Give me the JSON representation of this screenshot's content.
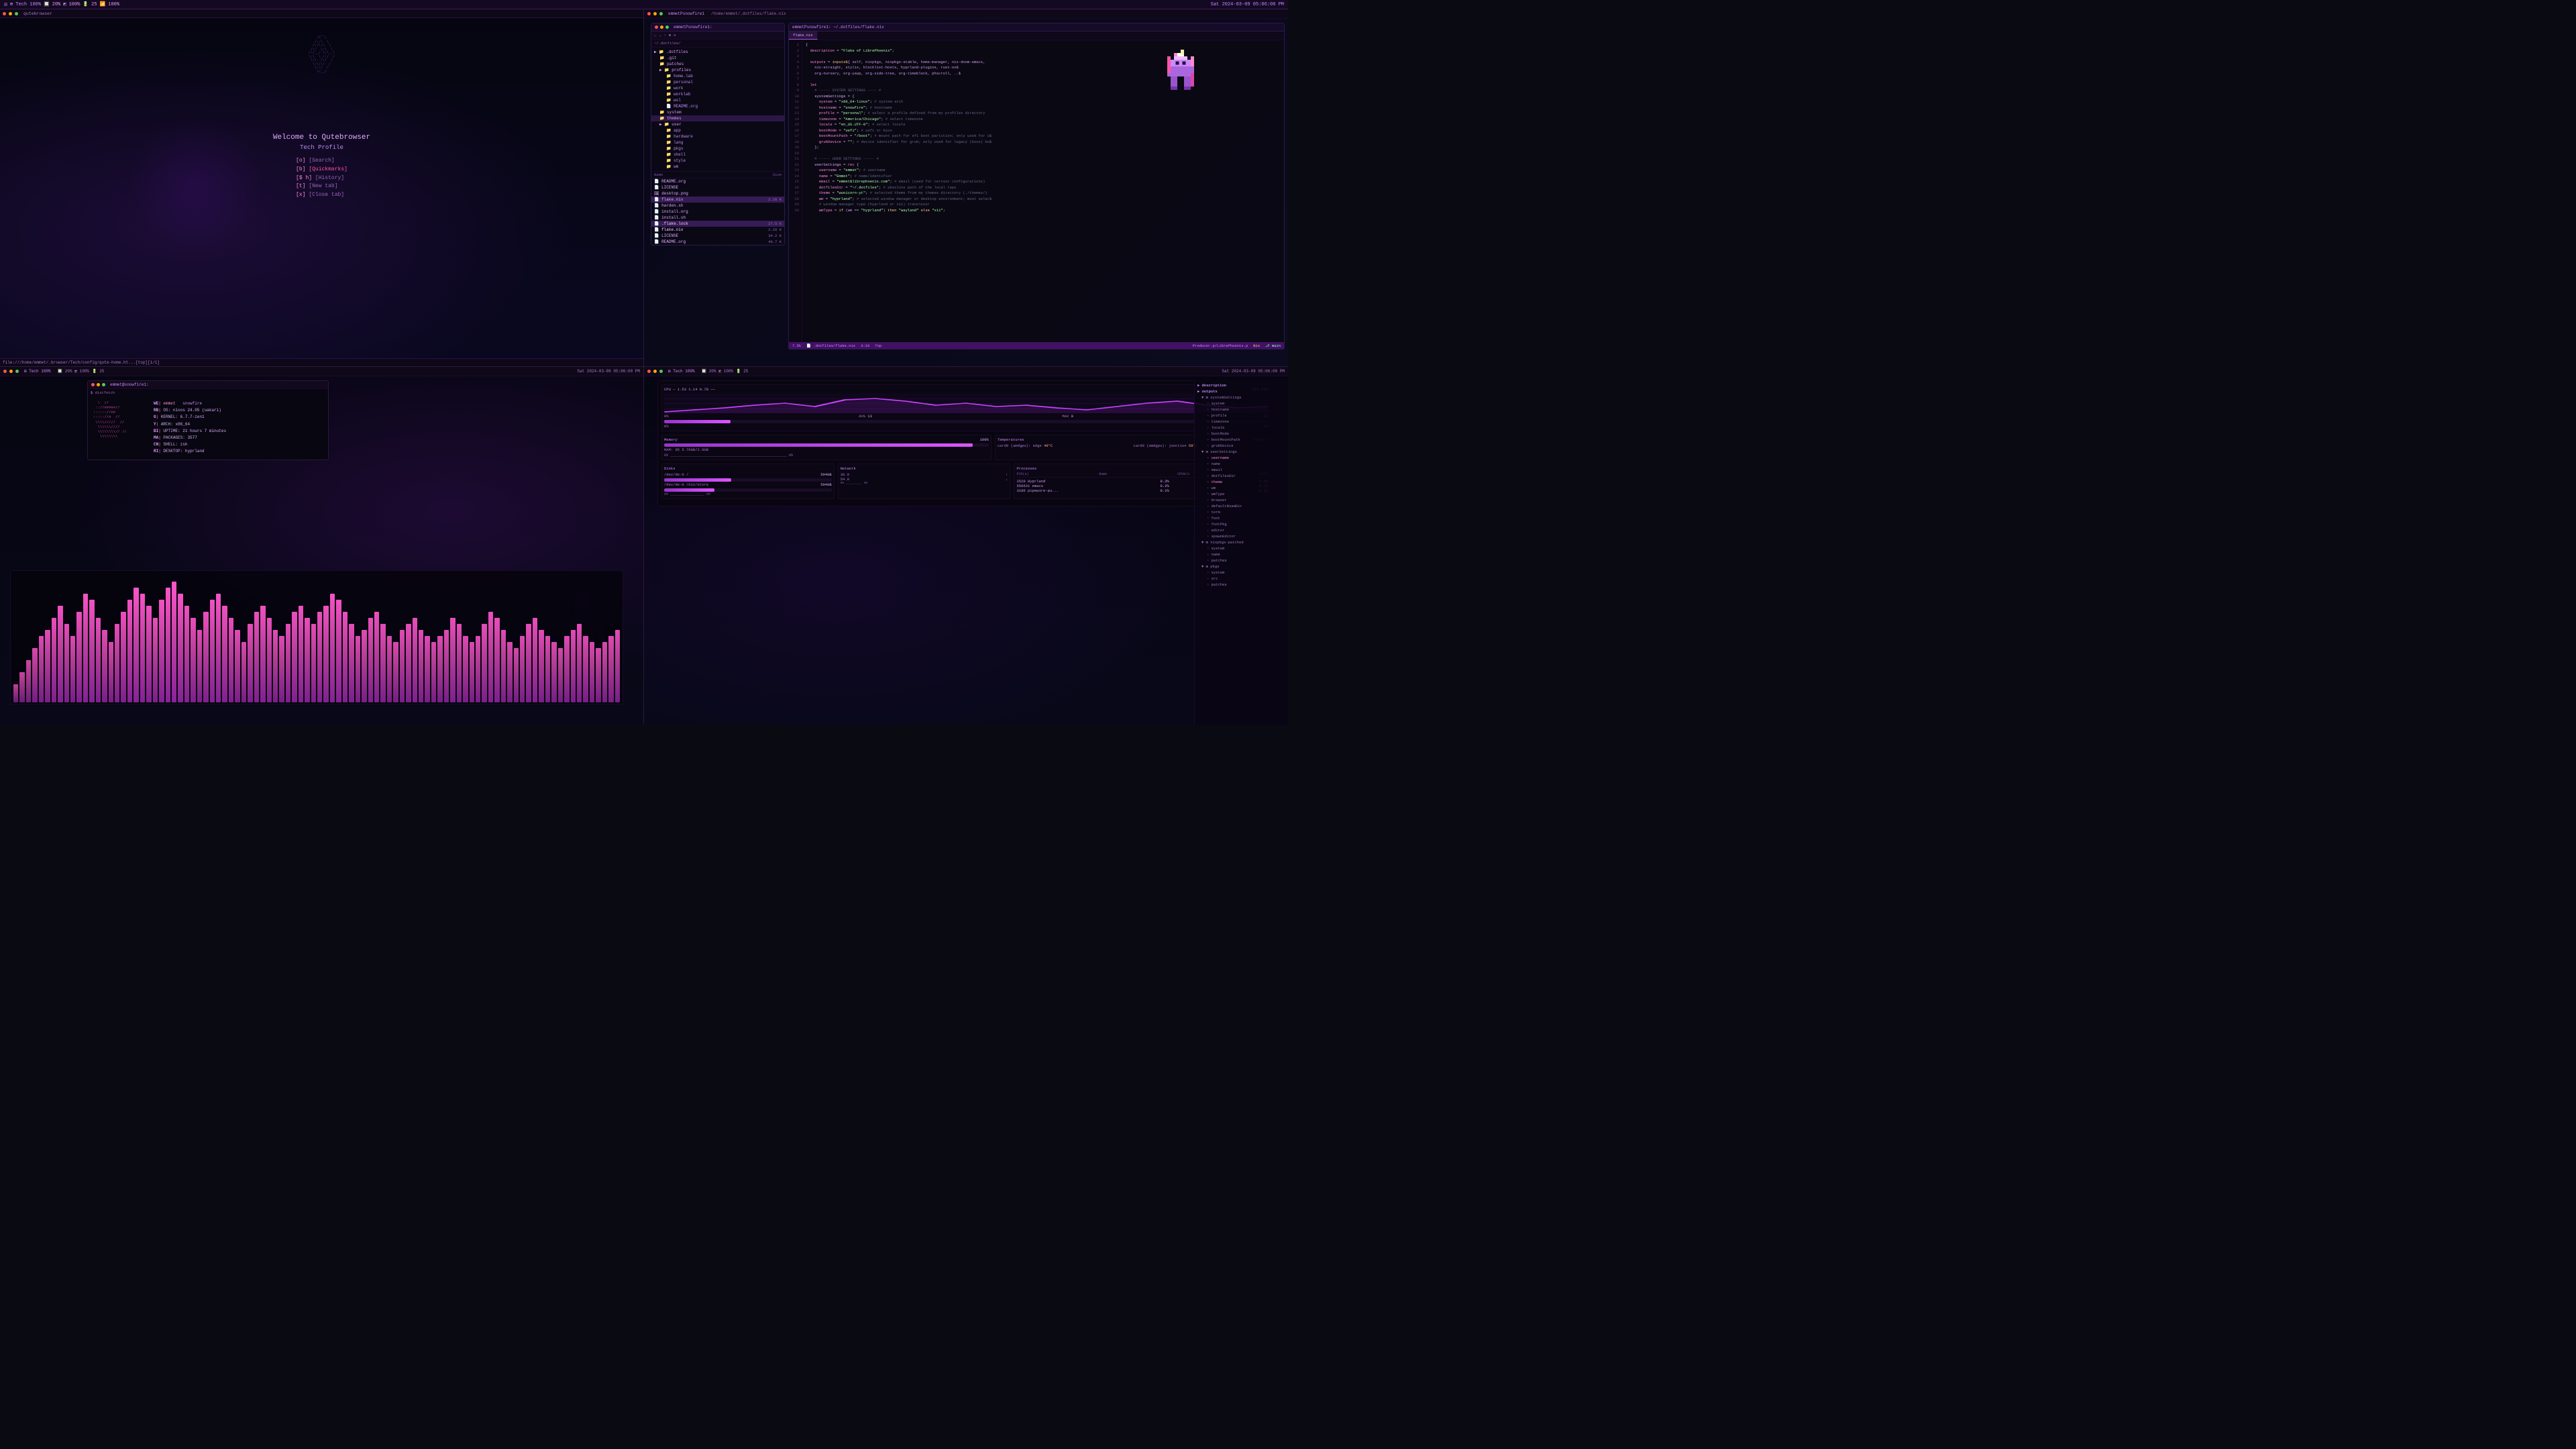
{
  "topbar": {
    "left": {
      "apps": "⊞ Tech 100%",
      "cpu": "20%",
      "mem_icon": "◩",
      "mem": "100%",
      "bat": "25",
      "bat_icon": "🔋",
      "wifi": "100%",
      "sep1": "|"
    },
    "right": {
      "datetime": "Sat 2024-03-09 05:06:00 PM",
      "wifi2": "100%"
    }
  },
  "q1": {
    "title": "qutebrowser",
    "ascii": "     ,----,\n  ,/   .`|  ___\n,`   .'  :,' ,'\n;    ;     ; |\n,'   |  .\\  \\ |\n|    |  | ; | |\n:    ' /  | ' |\n|    |/   ' ; |\n;    ;    / | |\n`----'   ;  | |\n        /   | |\n       /    | |\n      ;     | |\n      |     | |\n       \\    |\n        \\   |\n         \\  |\n          `--'",
    "welcome": "Welcome to Qutebrowser",
    "profile": "Tech Profile",
    "commands": [
      {
        "key": "[o]",
        "label": "[Search]"
      },
      {
        "key": "[b]",
        "label": "[Quickmarks]",
        "highlight": true
      },
      {
        "key": "[$ h]",
        "label": "[History]"
      },
      {
        "key": "[t]",
        "label": "[New tab]"
      },
      {
        "key": "[x]",
        "label": "[Close tab]"
      }
    ],
    "statusbar": "file:///home/emmet/.browser/Tech/config/qute-home.ht...[top][1/1]"
  },
  "q2": {
    "title": "emmetPsnowfire1",
    "path": "/home/emmet/.dotfiles/flake.nix",
    "file_manager": {
      "title": "emmetPsnowfire1:",
      "toolbar_items": [
        "←",
        "→",
        "↑",
        "⊞",
        "≡"
      ],
      "path": "~/.dotfiles/",
      "tree": [
        {
          "name": ".dotfiles",
          "type": "folder",
          "indent": 0,
          "open": true
        },
        {
          "name": ".git",
          "type": "folder",
          "indent": 1
        },
        {
          "name": "patches",
          "type": "folder",
          "indent": 1
        },
        {
          "name": "profiles",
          "type": "folder",
          "indent": 1,
          "open": true
        },
        {
          "name": "home.lab",
          "type": "folder",
          "indent": 2
        },
        {
          "name": "personal",
          "type": "folder",
          "indent": 2
        },
        {
          "name": "work",
          "type": "folder",
          "indent": 2
        },
        {
          "name": "worklab",
          "type": "folder",
          "indent": 2
        },
        {
          "name": "wsl",
          "type": "folder",
          "indent": 2
        },
        {
          "name": "README.org",
          "type": "file",
          "indent": 2
        },
        {
          "name": "system",
          "type": "folder",
          "indent": 1
        },
        {
          "name": "themes",
          "type": "folder",
          "indent": 1,
          "selected": true
        },
        {
          "name": "user",
          "type": "folder",
          "indent": 1,
          "open": true
        },
        {
          "name": "app",
          "type": "folder",
          "indent": 2
        },
        {
          "name": "hardware",
          "type": "folder",
          "indent": 2
        },
        {
          "name": "lang",
          "type": "folder",
          "indent": 2
        },
        {
          "name": "pkgs",
          "type": "folder",
          "indent": 2
        },
        {
          "name": "shell",
          "type": "folder",
          "indent": 2
        },
        {
          "name": "style",
          "type": "folder",
          "indent": 2
        },
        {
          "name": "wm",
          "type": "folder",
          "indent": 2
        }
      ],
      "files": [
        {
          "name": "README.org",
          "size": ""
        },
        {
          "name": "LICENSE",
          "size": ""
        },
        {
          "name": "README.org",
          "size": ""
        },
        {
          "name": "desktop.png",
          "size": ""
        },
        {
          "name": "flake.nix",
          "size": "2.26 K",
          "selected": true
        },
        {
          "name": "harden.sh",
          "size": ""
        },
        {
          "name": "install.org",
          "size": ""
        },
        {
          "name": "install.sh",
          "size": ""
        },
        {
          "name": ".flake.lock",
          "size": "27.5 K"
        },
        {
          "name": ".flake.nix",
          "size": "2.26 K"
        },
        {
          "name": "install.org",
          "size": ""
        },
        {
          "name": "LICENSE",
          "size": "34.2 K"
        },
        {
          "name": "README.org",
          "size": "40.7 K"
        }
      ]
    },
    "editor": {
      "tabs": [
        "flake.nix"
      ],
      "lines": [
        {
          "n": 1,
          "code": "{",
          "type": "plain"
        },
        {
          "n": 2,
          "code": "  description = \"Flake of LibrePhoenix\";",
          "type": "code"
        },
        {
          "n": 3,
          "code": "",
          "type": "plain"
        },
        {
          "n": 4,
          "code": "  outputs = inputs${ self, nixpkgs, nixpkgs-stable, home-manager, nix-doom-emacs,",
          "type": "code"
        },
        {
          "n": 5,
          "code": "    nix-straight, stylix, blocklist-hosts, hyprland-plugins, rust-ov$",
          "type": "code"
        },
        {
          "n": 6,
          "code": "    org-nursery, org-yaap, org-side-tree, org-timeblock, phscroll, ..$",
          "type": "code"
        },
        {
          "n": 7,
          "code": "",
          "type": "plain"
        },
        {
          "n": 8,
          "code": "  let",
          "type": "code"
        },
        {
          "n": 9,
          "code": "    # ----- SYSTEM SETTINGS ---- #",
          "type": "comment"
        },
        {
          "n": 10,
          "code": "    systemSettings = {",
          "type": "code"
        },
        {
          "n": 11,
          "code": "      system = \"x86_64-linux\"; # system arch",
          "type": "code"
        },
        {
          "n": 12,
          "code": "      hostname = \"snowfire\"; # hostname",
          "type": "code"
        },
        {
          "n": 13,
          "code": "      profile = \"personal\"; # select a profile defined from my profiles directory",
          "type": "code"
        },
        {
          "n": 14,
          "code": "      timezone = \"America/Chicago\"; # select timezone",
          "type": "code"
        },
        {
          "n": 15,
          "code": "      locale = \"en_US.UTF-8\"; # select locale",
          "type": "code"
        },
        {
          "n": 16,
          "code": "      bootMode = \"uefi\"; # uefi or bios",
          "type": "code"
        },
        {
          "n": 17,
          "code": "      bootMountPath = \"/boot\"; # mount path for efi boot partition; only used for u$",
          "type": "code"
        },
        {
          "n": 18,
          "code": "      grubDevice = \"\"; # device identifier for grub; only used for legacy (bios) bo$",
          "type": "code"
        },
        {
          "n": 19,
          "code": "    };",
          "type": "code"
        },
        {
          "n": 20,
          "code": "",
          "type": "plain"
        },
        {
          "n": 21,
          "code": "    # ----- USER SETTINGS ----- #",
          "type": "comment"
        },
        {
          "n": 22,
          "code": "    userSettings = rec {",
          "type": "code"
        },
        {
          "n": 23,
          "code": "      username = \"emmet\"; # username",
          "type": "code"
        },
        {
          "n": 24,
          "code": "      name = \"Emmet\"; # name/identifier",
          "type": "code"
        },
        {
          "n": 25,
          "code": "      email = \"emmet$librephoenix.com\"; # email (used for certain configurations)",
          "type": "code"
        },
        {
          "n": 26,
          "code": "      dotfilesDir = \"~/.dotfiles\"; # absolute path of the local repo",
          "type": "code"
        },
        {
          "n": 27,
          "code": "      theme = \"wunicorn-yt\"; # selected theme from my themes directory (./themes/)",
          "type": "code"
        },
        {
          "n": 28,
          "code": "      wm = \"hyprland\"; # selected window manager or desktop environment; must selec$",
          "type": "code"
        },
        {
          "n": 29,
          "code": "      # window manager type (hyprland or x11) translator",
          "type": "comment"
        },
        {
          "n": 30,
          "code": "      wmType = if (wm == \"hyprland\") then \"wayland\" else \"x11\";",
          "type": "code"
        }
      ],
      "statusbar": {
        "left": "7.5k",
        "file": ".dotfiles/flake.nix",
        "pos": "3:10",
        "top": "Top",
        "mode": "Producer.p/LibrePhoenix.p",
        "lang": "Nix",
        "branch": "main"
      }
    }
  },
  "q3": {
    "title": "emmet@snowfire1:",
    "topbar": {
      "apps": "⊞ Tech 100%",
      "cpu": "20%",
      "mem": "100%",
      "bat": "25",
      "wifi": "100%"
    },
    "neofetch": {
      "art_lines": [
        "  \\\\  //",
        " ::://####//",
        "::::::://## ",
        "::::::://##  //",
        " \\\\\\\\\\\\/////// //",
        "  \\\\\\\\\\\\\\\\///// ",
        "  \\\\\\\\\\\\\\\\\\\\// //",
        "   \\\\\\\\\\\\\\\\\\\\ "
      ],
      "user": "emmet",
      "host": "snowfire",
      "os_label": "OS:",
      "os": "nixos 24.05 (uakari)",
      "kernel_label": "KERNEL:",
      "kernel": "6.7.7-zen1",
      "arch_label": "ARCH:",
      "arch": "x86_64",
      "uptime_label": "UPTIME:",
      "uptime": "21 hours 7 minutes",
      "packages_label": "PACKAGES:",
      "packages": "3577",
      "shell_label": "SHELL:",
      "shell": "zsh",
      "desktop_label": "DESKTOP:",
      "desktop": "hyprland"
    },
    "viz": {
      "bars": [
        15,
        25,
        35,
        45,
        55,
        60,
        70,
        80,
        65,
        55,
        75,
        90,
        85,
        70,
        60,
        50,
        65,
        75,
        85,
        95,
        90,
        80,
        70,
        85,
        95,
        100,
        90,
        80,
        70,
        60,
        75,
        85,
        90,
        80,
        70,
        60,
        50,
        65,
        75,
        80,
        70,
        60,
        55,
        65,
        75,
        80,
        70,
        65,
        75,
        80,
        90,
        85,
        75,
        65,
        55,
        60,
        70,
        75,
        65,
        55,
        50,
        60,
        65,
        70,
        60,
        55,
        50,
        55,
        60,
        70,
        65,
        55,
        50,
        55,
        65,
        75,
        70,
        60,
        50,
        45,
        55,
        65,
        70,
        60,
        55,
        50,
        45,
        55,
        60,
        65,
        55,
        50,
        45,
        50,
        55,
        60
      ]
    }
  },
  "q4": {
    "title": "emmet@snowfire1:",
    "topbar": {
      "apps": "⊞ Tech 100%",
      "cpu": "20%",
      "mem": "100%",
      "bat": "25",
      "wifi": "100%",
      "datetime": "Sat 2024-03-09 05:06:00 PM"
    },
    "sysmon": {
      "cpu": {
        "label": "CPU",
        "current": "1.53 1.14 0.78",
        "percent": 11,
        "avg": 13,
        "max": 0
      },
      "memory": {
        "label": "Memory",
        "percent": 95,
        "used": "5.76GB",
        "total": "2.0GB"
      },
      "temperatures": {
        "label": "Temperatures",
        "items": [
          {
            "name": "card0 (amdgpu): edge",
            "temp": "49°C"
          },
          {
            "name": "card0 (amdgpu): junction",
            "temp": "58°C"
          }
        ]
      },
      "disks": {
        "label": "Disks",
        "items": [
          {
            "path": "/dev/de-0 /",
            "size": "504GB"
          },
          {
            "path": "/dev/de-0 /nix/store",
            "size": "504GB"
          }
        ]
      },
      "network": {
        "label": "Network",
        "sent": "36.0",
        "recv": "54.0",
        "unit": "MB"
      },
      "processes": {
        "label": "Processes",
        "headers": [
          "PID(s)",
          "Name",
          "CPU%/s",
          "MEM%"
        ],
        "items": [
          {
            "pid": "2520",
            "name": "Hyprland",
            "cpu": "0.3%",
            "mem": "0.4%"
          },
          {
            "pid": "550631",
            "name": "emacs",
            "cpu": "0.2%",
            "mem": "0.7%"
          },
          {
            "pid": "3180",
            "name": "pipewire-pu...",
            "cpu": "0.1%",
            "mem": "0.1%"
          }
        ]
      }
    },
    "right_tree": {
      "sections": [
        {
          "name": "description",
          "type": "group",
          "indent": 0
        },
        {
          "name": "outputs",
          "type": "group",
          "indent": 0
        },
        {
          "name": "systemSettings",
          "type": "group",
          "indent": 1
        },
        {
          "name": "system",
          "type": "item",
          "indent": 2
        },
        {
          "name": "hostname",
          "type": "item",
          "indent": 2
        },
        {
          "name": "profile",
          "type": "item",
          "indent": 2
        },
        {
          "name": "timezone",
          "type": "item",
          "indent": 2
        },
        {
          "name": "locale",
          "type": "item",
          "indent": 2
        },
        {
          "name": "bootMode",
          "type": "item",
          "indent": 2
        },
        {
          "name": "bootMountPath",
          "type": "item",
          "indent": 2
        },
        {
          "name": "grubDevice",
          "type": "item",
          "indent": 2
        },
        {
          "name": "userSettings",
          "type": "group",
          "indent": 1
        },
        {
          "name": "username",
          "type": "item",
          "indent": 2
        },
        {
          "name": "name",
          "type": "item",
          "indent": 2
        },
        {
          "name": "email",
          "type": "item",
          "indent": 2
        },
        {
          "name": "dotfilesDir",
          "type": "item",
          "indent": 2
        },
        {
          "name": "theme",
          "type": "item",
          "indent": 2
        },
        {
          "name": "wm",
          "type": "item",
          "indent": 2
        },
        {
          "name": "wmType",
          "type": "item",
          "indent": 2
        },
        {
          "name": "browser",
          "type": "item",
          "indent": 2
        },
        {
          "name": "defaultRoamDir",
          "type": "item",
          "indent": 2
        },
        {
          "name": "term",
          "type": "item",
          "indent": 2
        },
        {
          "name": "font",
          "type": "item",
          "indent": 2
        },
        {
          "name": "fontPkg",
          "type": "item",
          "indent": 2
        },
        {
          "name": "editor",
          "type": "item",
          "indent": 2
        },
        {
          "name": "spawnEditor",
          "type": "item",
          "indent": 2
        },
        {
          "name": "nixpkgs-patched",
          "type": "group",
          "indent": 1
        },
        {
          "name": "system",
          "type": "item",
          "indent": 2
        },
        {
          "name": "name",
          "type": "item",
          "indent": 2
        },
        {
          "name": "patches",
          "type": "item",
          "indent": 2
        },
        {
          "name": "pkgs",
          "type": "group",
          "indent": 1
        },
        {
          "name": "system",
          "type": "item",
          "indent": 2
        },
        {
          "name": "src",
          "type": "item",
          "indent": 2
        },
        {
          "name": "patches",
          "type": "item",
          "indent": 2
        }
      ]
    }
  }
}
